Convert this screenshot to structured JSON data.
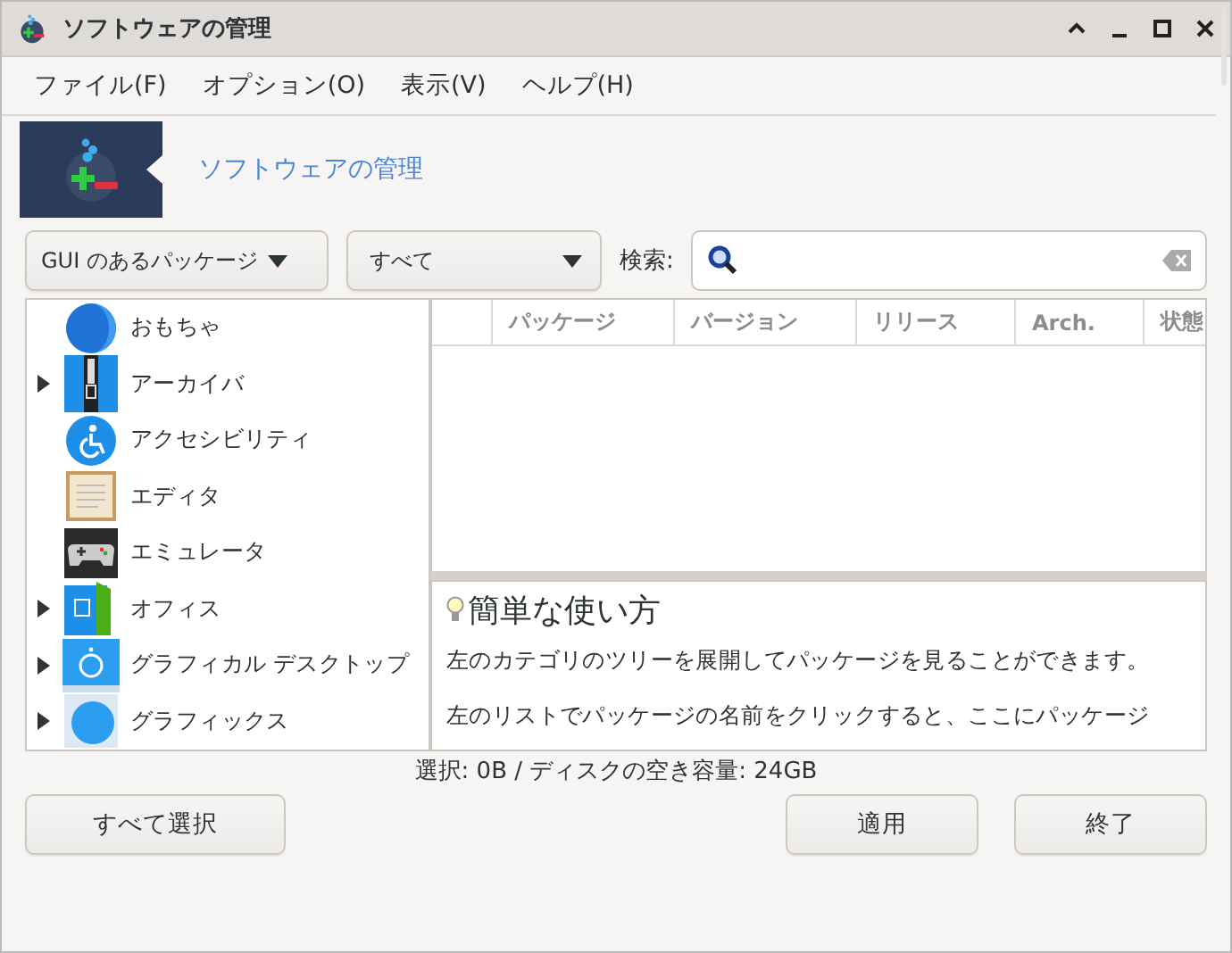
{
  "window": {
    "title": "ソフトウェアの管理"
  },
  "menu": [
    {
      "label": "ファイル(F)"
    },
    {
      "label": "オプション(O)"
    },
    {
      "label": "表示(V)"
    },
    {
      "label": "ヘルプ(H)"
    }
  ],
  "banner": {
    "title": "ソフトウェアの管理"
  },
  "filters": [
    {
      "label": "GUI のあるパッケージ"
    },
    {
      "label": "すべて"
    }
  ],
  "search": {
    "label": "検索:"
  },
  "categories": [
    {
      "label": "おもちゃ",
      "expandable": false
    },
    {
      "label": "アーカイバ",
      "expandable": true
    },
    {
      "label": "アクセシビリティ",
      "expandable": false
    },
    {
      "label": "エディタ",
      "expandable": false
    },
    {
      "label": "エミュレータ",
      "expandable": false
    },
    {
      "label": "オフィス",
      "expandable": true
    },
    {
      "label": "グラフィカル デスクトップ",
      "expandable": true
    },
    {
      "label": "グラフィックス",
      "expandable": true
    }
  ],
  "table": {
    "columns": [
      "パッケージ",
      "バージョン",
      "リリース",
      "Arch.",
      "状態"
    ]
  },
  "description": {
    "heading": "簡単な使い方",
    "paragraphs": [
      "左のカテゴリのツリーを展開してパッケージを見ることができます。",
      "左のリストでパッケージの名前をクリックすると、ここにパッケージ"
    ]
  },
  "status_bar": "選択: 0B / ディスクの空き容量: 24GB",
  "buttons": [
    {
      "label": "すべて選択"
    },
    {
      "label": "適用"
    },
    {
      "label": "終了"
    }
  ]
}
